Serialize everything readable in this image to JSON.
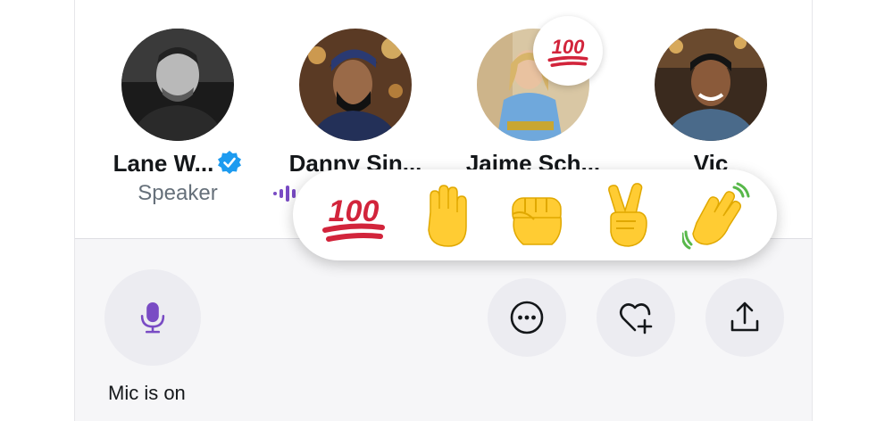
{
  "speakers": [
    {
      "name": "Lane W...",
      "role": "Speaker",
      "verified": true,
      "avatar_icon": "person-photo-bw"
    },
    {
      "name": "Danny Sin...",
      "avatar_icon": "person-photo-turban"
    },
    {
      "name": "Jaime Sch...",
      "avatar_icon": "person-photo-blonde",
      "reaction": "100"
    },
    {
      "name": "Vic",
      "avatar_icon": "person-photo-smiling"
    }
  ],
  "reactions": [
    "100",
    "raised-hand",
    "raised-fist",
    "victory-hand",
    "waving-hand"
  ],
  "controls": {
    "mic_label": "Mic is on",
    "mic_icon": "microphone-icon",
    "more_icon": "more-dots-icon",
    "favorite_icon": "heart-plus-icon",
    "share_icon": "share-icon"
  },
  "colors": {
    "accent": "#794bc4",
    "verified": "#1d9bf0",
    "reaction_red": "#d2243b",
    "emoji_yellow": "#ffcc33"
  }
}
